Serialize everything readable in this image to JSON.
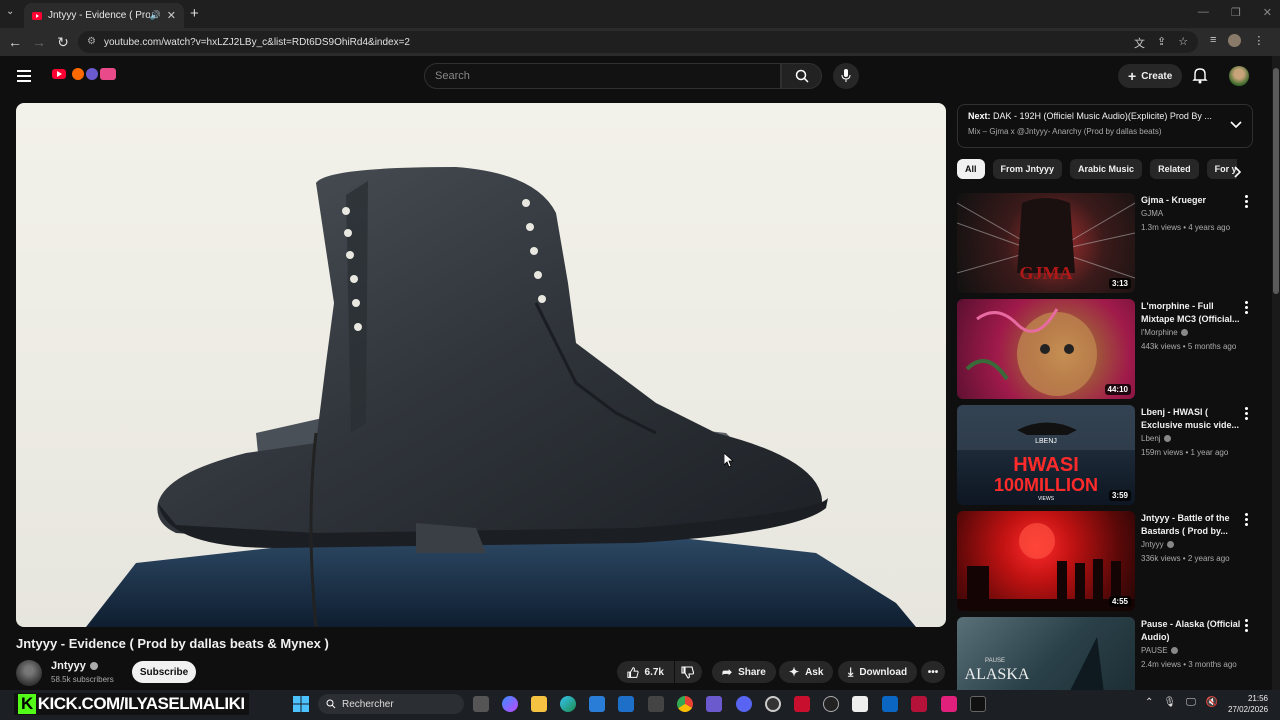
{
  "browser": {
    "tab_title": "Jntyyy - Evidence ( Prod by",
    "tab_close": "✕",
    "new_tab": "+",
    "url": "youtube.com/watch?v=hxLZJ2LBy_c&list=RDt6DS9OhiRd4&index=2"
  },
  "header": {
    "search_placeholder": "Search",
    "create_label": "Create"
  },
  "video": {
    "title": "Jntyyy - Evidence ( Prod by dallas beats & Mynex )",
    "channel": "Jntyyy",
    "subscribers": "58.5k subscribers",
    "subscribe_label": "Subscribe",
    "likes": "6.7k",
    "share_label": "Share",
    "ask_label": "Ask",
    "download_label": "Download"
  },
  "playlist_next": {
    "prefix": "Next:",
    "title": "DAK - 192H (Officiel Music Audio)(Explicite) Prod By ...",
    "subtitle": "Mix – Gjma x @Jntyyy- Anarchy (Prod by dallas beats)"
  },
  "chips": [
    "All",
    "From Jntyyy",
    "Arabic Music",
    "Related",
    "For y"
  ],
  "recommendations": [
    {
      "title": "Gjma - Krueger",
      "channel": "GJMA",
      "meta": "1.3m views • 4 years ago",
      "duration": "3:13",
      "verified": false,
      "colors": [
        "#3b1a1a",
        "#9a2a2a",
        "#111"
      ]
    },
    {
      "title": "L'morphine - Full Mixtape MC3 (Official...",
      "channel": "l'Morphine",
      "meta": "443k views • 5 months ago",
      "duration": "44:10",
      "verified": true,
      "colors": [
        "#a01a4a",
        "#d4a35a",
        "#3a6a3a"
      ]
    },
    {
      "title": "Lbenj - HWASI ( Exclusive music vide...",
      "channel": "Lbenj",
      "meta": "159m views • 1 year ago",
      "duration": "3:59",
      "verified": true,
      "colors": [
        "#1a2838",
        "#c81a1a",
        "#0d1622"
      ]
    },
    {
      "title": "Jntyyy - Battle of the Bastards ( Prod by...",
      "channel": "Jntyyy",
      "meta": "336k views • 2 years ago",
      "duration": "4:55",
      "verified": true,
      "colors": [
        "#d01818",
        "#6a0a0a",
        "#200606"
      ]
    },
    {
      "title": "Pause - Alaska (Official Audio)",
      "channel": "PAUSE",
      "meta": "2.4m views • 3 months ago",
      "duration": "",
      "verified": true,
      "colors": [
        "#2a4048",
        "#1a2a30",
        "#5a7078"
      ]
    }
  ],
  "thumb_text": {
    "krueger": "GJMA",
    "hwasi_top": "LBENJ",
    "hwasi_big": "HWASI",
    "hwasi_sub": "100MILLION",
    "hwasi_views": "VIEWS",
    "alaska_small": "PAUSE",
    "alaska_big": "ALASKA"
  },
  "taskbar": {
    "overlay_text": "KICK.COM/ILYASELMALIKI",
    "overlay_k": "K",
    "search_label": "Rechercher",
    "time": "21:56",
    "date": "27/02/2026"
  }
}
